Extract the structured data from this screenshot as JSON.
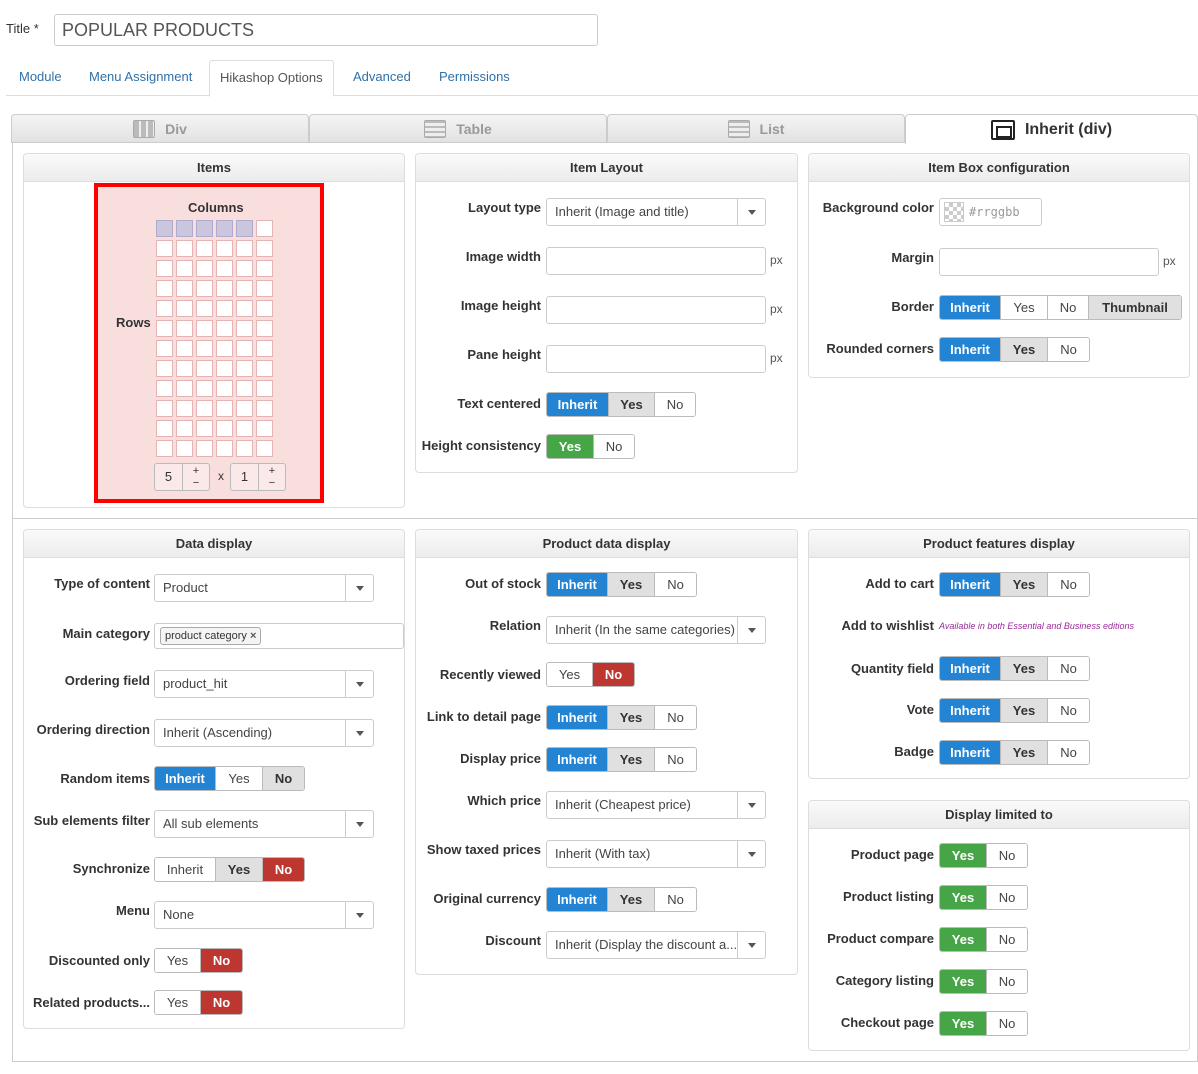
{
  "title": {
    "label": "Title *",
    "value": "POPULAR PRODUCTS"
  },
  "tabs": [
    "Module",
    "Menu Assignment",
    "Hikashop Options",
    "Advanced",
    "Permissions"
  ],
  "view_tabs": [
    "Div",
    "Table",
    "List",
    "Inherit (div)"
  ],
  "items_panel": {
    "header": "Items",
    "columns_label": "Columns",
    "rows_label": "Rows",
    "columns_value": "5",
    "x": "x",
    "rows_value": "1",
    "plus": "+",
    "minus": "−",
    "grid_cols": 6,
    "grid_rows": 12,
    "selected_cols": 5,
    "selected_rows": 1
  },
  "item_layout": {
    "header": "Item Layout",
    "layout_type_label": "Layout type",
    "layout_type_value": "Inherit (Image and title)",
    "image_width_label": "Image width",
    "image_height_label": "Image height",
    "pane_height_label": "Pane height",
    "px": "px",
    "text_centered_label": "Text centered",
    "height_consistency_label": "Height consistency"
  },
  "item_box": {
    "header": "Item Box configuration",
    "bg_color_label": "Background color",
    "bg_color_placeholder": "#rrggbb",
    "margin_label": "Margin",
    "border_label": "Border",
    "rounded_label": "Rounded corners",
    "thumbnail": "Thumbnail"
  },
  "data_display": {
    "header": "Data display",
    "type_label": "Type of content",
    "type_value": "Product",
    "main_category_label": "Main category",
    "main_category_tag": "product category",
    "tag_close": "×",
    "ordering_field_label": "Ordering field",
    "ordering_field_value": "product_hit",
    "ordering_dir_label": "Ordering direction",
    "ordering_dir_value": "Inherit (Ascending)",
    "random_label": "Random items",
    "sub_filter_label": "Sub elements filter",
    "sub_filter_value": "All sub elements",
    "sync_label": "Synchronize",
    "menu_label": "Menu",
    "menu_value": "None",
    "discounted_label": "Discounted only",
    "related_label": "Related products..."
  },
  "product_data": {
    "header": "Product data display",
    "out_of_stock_label": "Out of stock",
    "relation_label": "Relation",
    "relation_value": "Inherit (In the same categories)",
    "recently_viewed_label": "Recently viewed",
    "link_detail_label": "Link to detail page",
    "display_price_label": "Display price",
    "which_price_label": "Which price",
    "which_price_value": "Inherit (Cheapest price)",
    "taxed_label": "Show taxed prices",
    "taxed_value": "Inherit (With tax)",
    "orig_currency_label": "Original currency",
    "discount_label": "Discount",
    "discount_value": "Inherit (Display the discount a..."
  },
  "features": {
    "header": "Product features display",
    "add_cart_label": "Add to cart",
    "wishlist_label": "Add to wishlist",
    "wishlist_note": "Available in both Essential and Business editions",
    "quantity_label": "Quantity field",
    "vote_label": "Vote",
    "badge_label": "Badge"
  },
  "limited": {
    "header": "Display limited to",
    "product_page": "Product page",
    "product_listing": "Product listing",
    "product_compare": "Product compare",
    "category_listing": "Category listing",
    "checkout_page": "Checkout page"
  },
  "opts": {
    "inherit": "Inherit",
    "yes": "Yes",
    "no": "No"
  },
  "colors": {
    "blue": "#2384d3",
    "green": "#46a546",
    "red": "#bd362f",
    "highlight": "#ff0000"
  }
}
